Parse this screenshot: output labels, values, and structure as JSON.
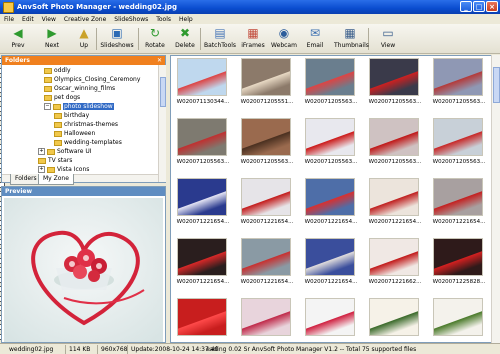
{
  "window": {
    "title": "AnvSoft Photo Manager  -  wedding02.jpg"
  },
  "menu": [
    "File",
    "Edit",
    "View",
    "Creative Zone",
    "SlideShows",
    "Tools",
    "Help"
  ],
  "toolbar": [
    {
      "label": "Prev",
      "icon": "left-arrow-icon",
      "glyph": "◀",
      "color": "#2f9a2f"
    },
    {
      "label": "Next",
      "icon": "right-arrow-icon",
      "glyph": "▶",
      "color": "#2f9a2f"
    },
    {
      "label": "Up",
      "icon": "folder-up-icon",
      "glyph": "▲",
      "color": "#caa22a"
    },
    {
      "label": "Slideshows",
      "icon": "slideshow-icon",
      "glyph": "▣",
      "color": "#2c6bb5"
    },
    {
      "label": "Rotate",
      "icon": "rotate-icon",
      "glyph": "↻",
      "color": "#2f9a2f"
    },
    {
      "label": "Delete",
      "icon": "delete-icon",
      "glyph": "✖",
      "color": "#2f9a2f"
    },
    {
      "label": "BatchTools",
      "icon": "batch-tools-icon",
      "glyph": "▤",
      "color": "#4a78b8"
    },
    {
      "label": "iFrames",
      "icon": "iframes-icon",
      "glyph": "▦",
      "color": "#c24a3a"
    },
    {
      "label": "Webcam",
      "icon": "webcam-icon",
      "glyph": "◉",
      "color": "#2c5d9c"
    },
    {
      "label": "Email",
      "icon": "email-icon",
      "glyph": "✉",
      "color": "#3b6fb0"
    },
    {
      "label": "Thumbnails",
      "icon": "thumbnails-icon",
      "glyph": "▦",
      "color": "#3b5f8c"
    },
    {
      "label": "View",
      "icon": "view-icon",
      "glyph": "▭",
      "color": "#3b5f8c"
    }
  ],
  "folders": {
    "title": "Folders",
    "items": [
      {
        "label": "oddly",
        "sel": false
      },
      {
        "label": "Olympics_Closing_Ceremony",
        "sel": false
      },
      {
        "label": "Oscar_winning_films",
        "sel": false
      },
      {
        "label": "pet dogs",
        "sel": false
      },
      {
        "label": "photo slideshow",
        "sel": true
      },
      {
        "label": "birthday",
        "sel": false
      },
      {
        "label": "christmas-themes",
        "sel": false
      },
      {
        "label": "Halloween",
        "sel": false
      },
      {
        "label": "wedding-templates",
        "sel": false
      },
      {
        "label": "Software UI",
        "sel": false
      },
      {
        "label": "TV stars",
        "sel": false
      },
      {
        "label": "Vista Icons",
        "sel": false
      },
      {
        "label": "Web Interface",
        "sel": false
      }
    ]
  },
  "tabs": [
    "Folders",
    "My Zone"
  ],
  "preview": {
    "title": "Preview"
  },
  "thumbnails": [
    {
      "cap": "W020071130344...",
      "bg": "#bfd8ee",
      "fg": "#d44"
    },
    {
      "cap": "W020071205551...",
      "bg": "#8c7a6a",
      "fg": "#e8d9c4"
    },
    {
      "cap": "W020071205563...",
      "bg": "#6a7e8e",
      "fg": "#d44"
    },
    {
      "cap": "W020071205563...",
      "bg": "#3a3a4a",
      "fg": "#cc2020"
    },
    {
      "cap": "W020071205563...",
      "bg": "#8f98b4",
      "fg": "#b43a3a"
    },
    {
      "cap": "W020071205563...",
      "bg": "#7e7a70",
      "fg": "#c03030"
    },
    {
      "cap": "W020071205563...",
      "bg": "#9a6a4e",
      "fg": "#4a3020"
    },
    {
      "cap": "W020071205563...",
      "bg": "#e8e8ee",
      "fg": "#cc1a1a"
    },
    {
      "cap": "W020071205563...",
      "bg": "#cfc2c2",
      "fg": "#c01818"
    },
    {
      "cap": "W020071205563...",
      "bg": "#c8d0d8",
      "fg": "#c82828"
    },
    {
      "cap": "W020071221654...",
      "bg": "#2a3a8e",
      "fg": "#e4e4f4"
    },
    {
      "cap": "W020071221654...",
      "bg": "#e6e4e8",
      "fg": "#c41c1c"
    },
    {
      "cap": "W020071221654...",
      "bg": "#4e6ea8",
      "fg": "#d83030"
    },
    {
      "cap": "W020071221654...",
      "bg": "#ece4dc",
      "fg": "#c02020"
    },
    {
      "cap": "W020071221654...",
      "bg": "#a8a0a0",
      "fg": "#c42020"
    },
    {
      "cap": "W020071221654...",
      "bg": "#2a1e1e",
      "fg": "#d82828"
    },
    {
      "cap": "W020071221654...",
      "bg": "#8a9aa4",
      "fg": "#c83030"
    },
    {
      "cap": "W020071221654...",
      "bg": "#3a4e9c",
      "fg": "#e0dcdc"
    },
    {
      "cap": "W020071221662...",
      "bg": "#f0e8e4",
      "fg": "#c21a1a"
    },
    {
      "cap": "W020071225828...",
      "bg": "#2e1a1a",
      "fg": "#d42020"
    },
    {
      "cap": "",
      "bg": "#c81e1e",
      "fg": "#ff4a4a"
    },
    {
      "cap": "",
      "bg": "#e8d4dc",
      "fg": "#c02a4a"
    },
    {
      "cap": "",
      "bg": "#f4f4f4",
      "fg": "#d02040"
    },
    {
      "cap": "",
      "bg": "#f6f2e8",
      "fg": "#3a6a2a"
    },
    {
      "cap": "",
      "bg": "#f4f2ec",
      "fg": "#4a7a2a"
    }
  ],
  "status": {
    "file": "wedding02.jpg",
    "size": "114 KB",
    "dims": "960x768",
    "update": "Update:2008-10-24 14:37:40",
    "info": "eading 0.02 Sr AnvSoft Photo Manager V1.2 -- Total 75 supported files"
  }
}
